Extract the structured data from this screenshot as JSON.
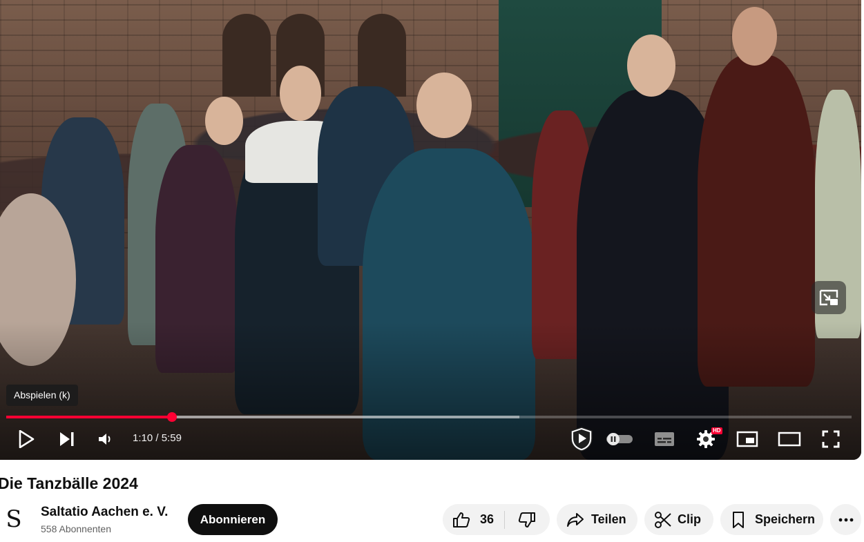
{
  "player": {
    "tooltip": "Abspielen (k)",
    "time_current": "1:10",
    "time_separator": " / ",
    "time_total": "5:59",
    "progress_played": 0.196,
    "progress_buffered": 0.607,
    "quality_badge": "HD",
    "accent_color": "#ff0033",
    "icons": [
      "play-icon",
      "next-icon",
      "volume-icon",
      "shield-play-icon",
      "autoplay-toggle-icon",
      "subtitles-icon",
      "settings-icon",
      "miniplayer-icon",
      "theater-mode-icon",
      "fullscreen-icon",
      "pip-icon"
    ]
  },
  "video": {
    "title": "Die Tanzbälle 2024"
  },
  "channel": {
    "avatar_glyph": "S",
    "name": "Saltatio Aachen e. V.",
    "subscribers": "558 Abonnenten",
    "subscribe_label": "Abonnieren"
  },
  "actions": {
    "like_count": "36",
    "share_label": "Teilen",
    "clip_label": "Clip",
    "save_label": "Speichern"
  }
}
